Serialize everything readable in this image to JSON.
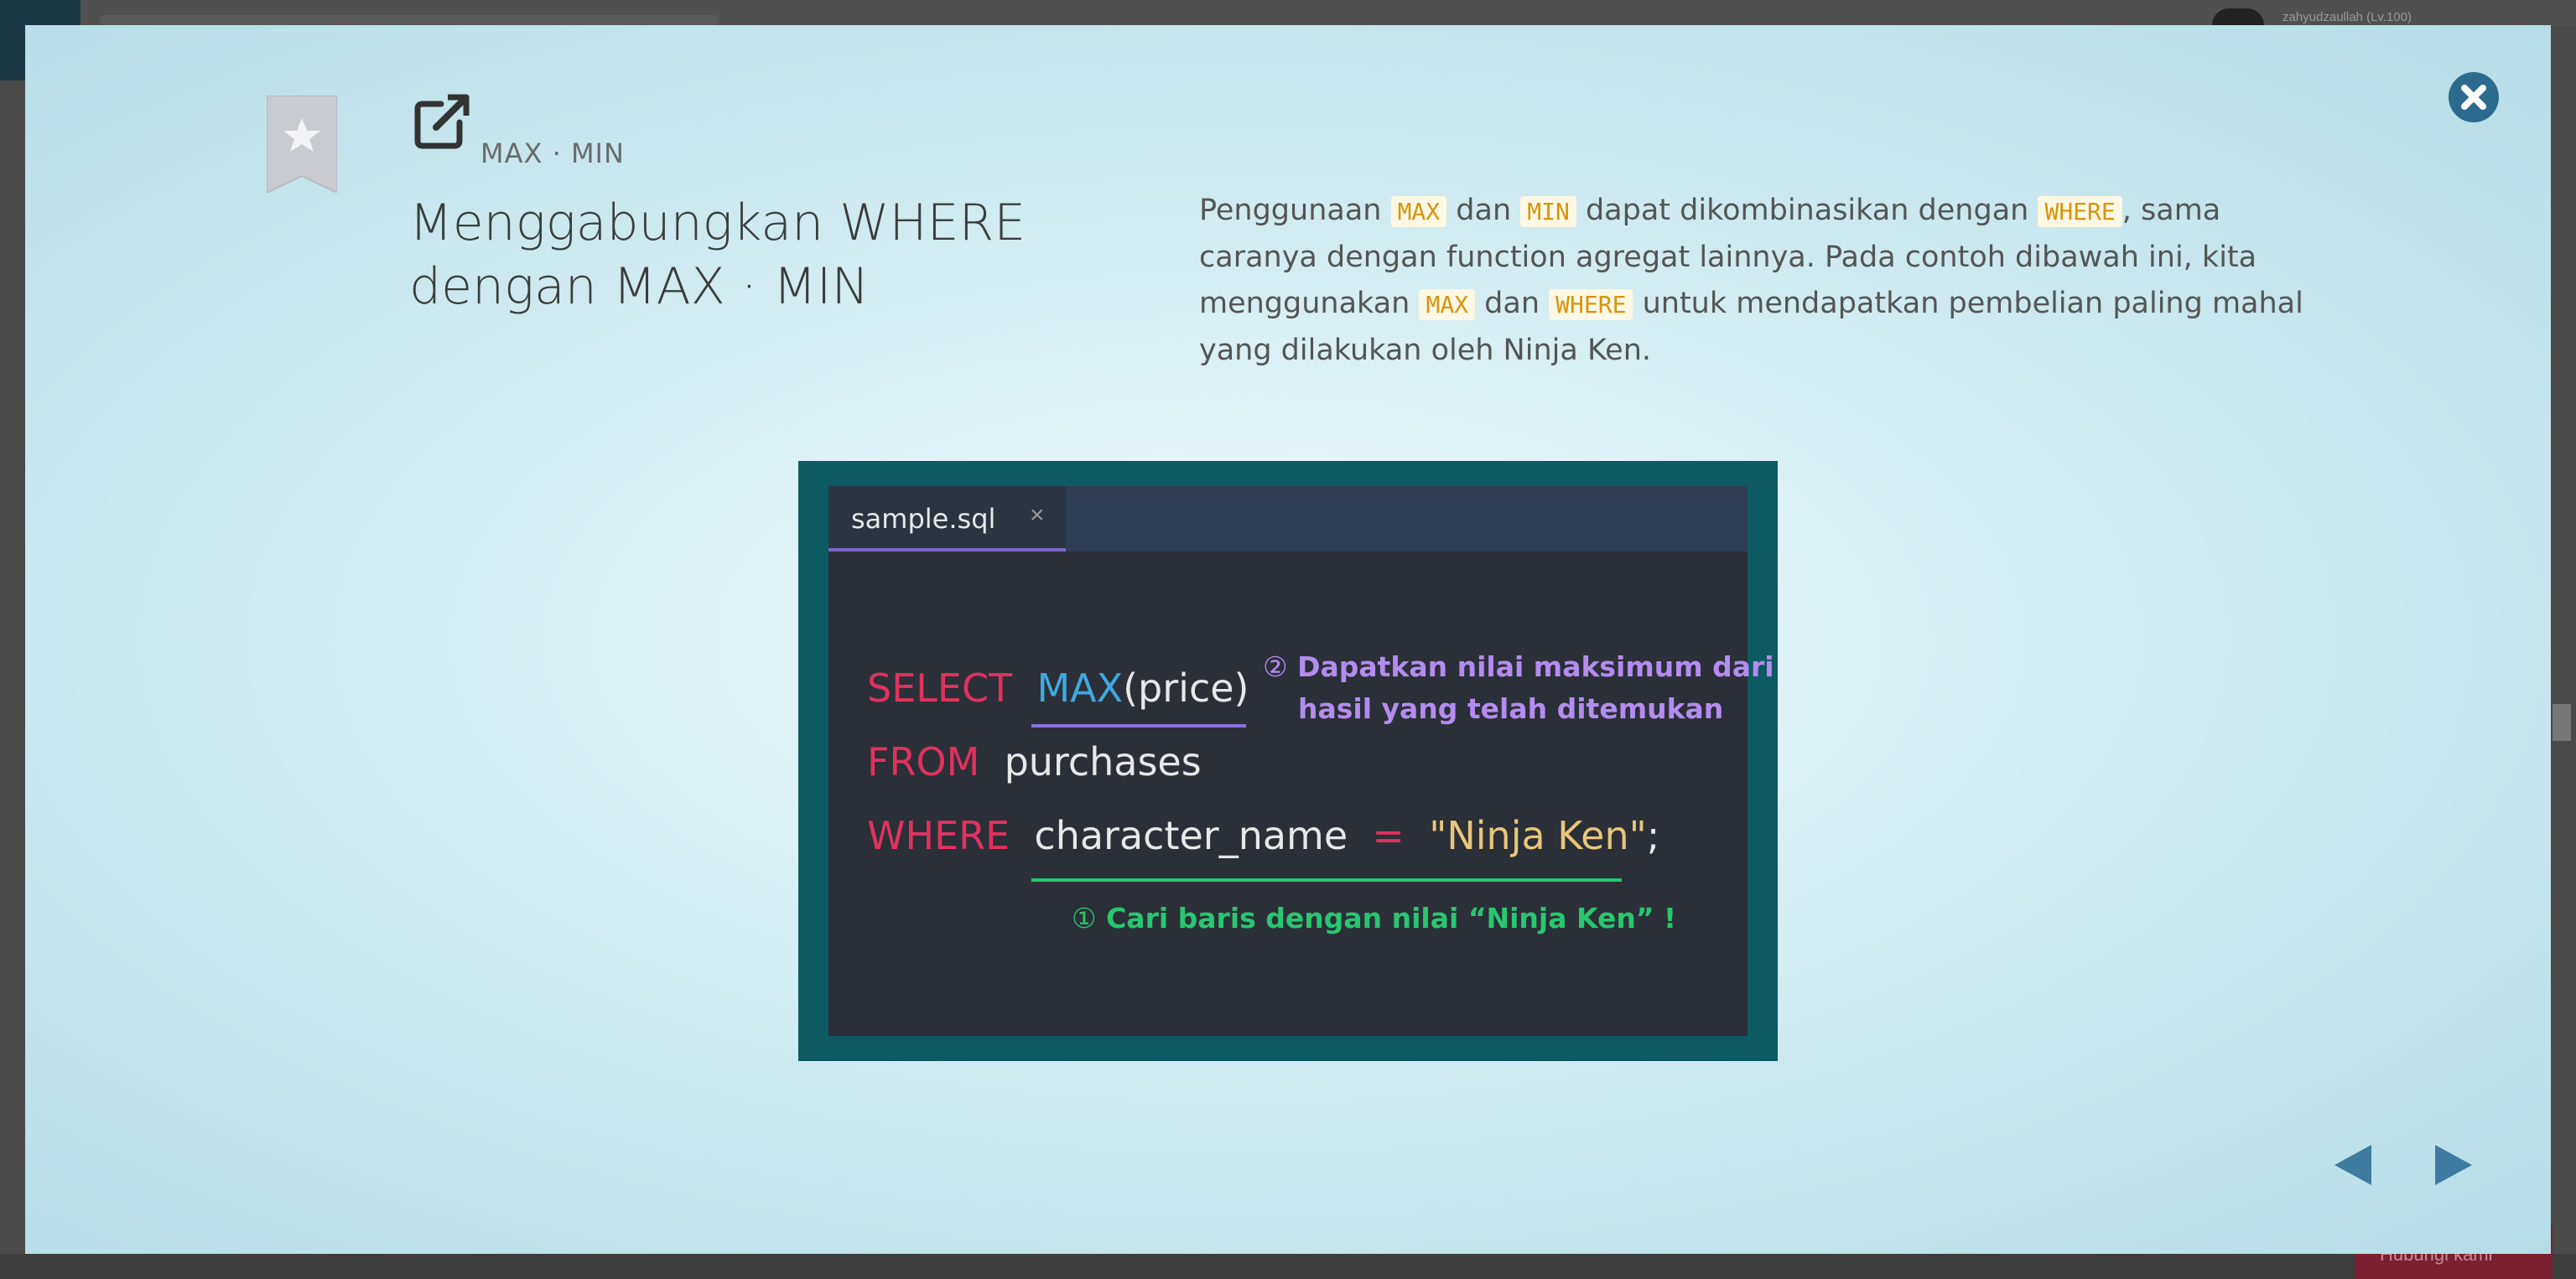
{
  "background": {
    "username": "zahyudzaullah (Lv.100)",
    "bottom_button_label": "Hubungi kami"
  },
  "slide": {
    "tag": "MAX · MIN",
    "title_line1": "Menggabungkan WHERE",
    "title_line2": "dengan MAX · MIN",
    "description": {
      "p1": "Penggunaan ",
      "c1": "MAX",
      "p2": " dan ",
      "c2": "MIN",
      "p3": " dapat dikombinasikan dengan ",
      "c3": "WHERE",
      "p4": ", sama caranya dengan function agregat lainnya. Pada contoh dibawah ini, kita menggunakan ",
      "c4": "MAX",
      "p5": " dan ",
      "c5": "WHERE",
      "p6": " untuk mendapatkan pembelian paling mahal yang dilakukan oleh Ninja Ken."
    },
    "icons": {
      "bookmark": "star-bookmark-icon",
      "external": "external-link-icon",
      "close": "close-icon",
      "prev": "prev-arrow-icon",
      "next": "next-arrow-icon"
    }
  },
  "figure": {
    "tab_name": "sample.sql",
    "tab_close": "×",
    "line1": {
      "keyword": "SELECT",
      "function": "MAX",
      "args": "(price)"
    },
    "line2": {
      "keyword": "FROM",
      "table": "purchases"
    },
    "line3": {
      "keyword": "WHERE",
      "column": "character_name",
      "op": "=",
      "value": "\"Ninja Ken\"",
      "end": ";"
    },
    "note2": {
      "num": "②",
      "line1": "Dapatkan nilai maksimum dari",
      "line2": "hasil yang telah ditemukan"
    },
    "note1": {
      "num": "①",
      "text": "Cari baris dengan nilai “Ninja Ken” !"
    }
  },
  "colors": {
    "accent_blue": "#2c6b8f",
    "code_keyword": "#e0325e",
    "code_function": "#3fa8df",
    "code_string": "#e8c67a",
    "note_purple": "#b48cf0",
    "note_green": "#28c76f",
    "inline_code": "#d8940e"
  }
}
